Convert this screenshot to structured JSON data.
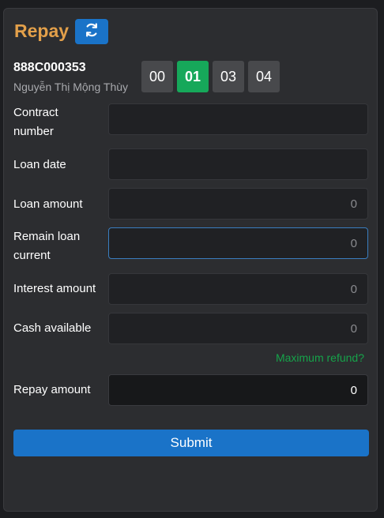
{
  "header": {
    "title": "Repay",
    "refresh_icon": "refresh-icon"
  },
  "account": {
    "id": "888C000353",
    "name": "Nguyễn Thị Mộng Thùy",
    "subaccounts": [
      "00",
      "01",
      "03",
      "04"
    ],
    "selected_subaccount": "01"
  },
  "fields": {
    "contract_number": {
      "label_line1": "Contract",
      "label_line2": "number",
      "value": ""
    },
    "loan_date": {
      "label": "Loan date",
      "value": ""
    },
    "loan_amount": {
      "label": "Loan amount",
      "value": "0"
    },
    "remain_loan": {
      "label_line1": "Remain loan",
      "label_line2": "current",
      "value": "0"
    },
    "interest_amount": {
      "label": "Interest amount",
      "value": "0"
    },
    "cash_available": {
      "label": "Cash available",
      "value": "0"
    },
    "repay_amount": {
      "label": "Repay amount",
      "value": "0"
    }
  },
  "max_refund_link": "Maximum refund?",
  "submit_label": "Submit",
  "colors": {
    "title": "#e3a04a",
    "primary": "#1a73c8",
    "active_subaccount": "#16a85a",
    "link": "#16a34a"
  }
}
